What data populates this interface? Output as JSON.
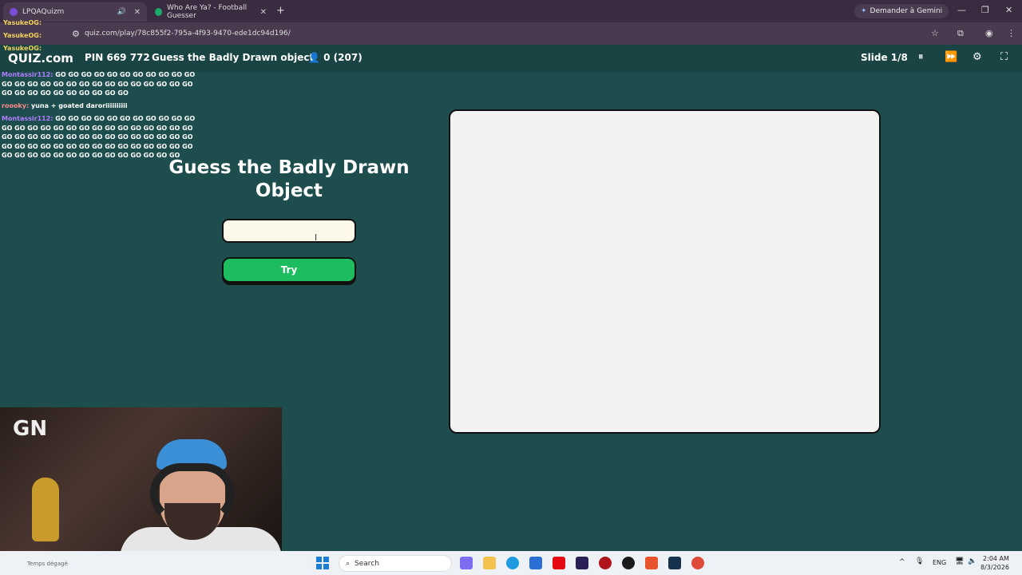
{
  "browser": {
    "tabs": [
      {
        "label": "LPQAQuizm"
      },
      {
        "label": "Who Are Ya? - Football Guesser"
      }
    ],
    "gemini_label": "Demander à Gemini",
    "url": "quiz.com/play/78c855f2-795a-4f93-9470-ede1dc94d196/"
  },
  "quiz_header": {
    "logo": "QUIZ.com",
    "pin": "PIN 669 772",
    "title": "Guess the Badly Drawn object",
    "players": "0 (207)",
    "slide": "Slide 1/8"
  },
  "chat": {
    "top_users": [
      "YasukeOG:",
      "YasukeOG:",
      "YasukeOG:"
    ],
    "messages": [
      {
        "user": "Montassir112:",
        "text": "GO GO GO GO GO GO GO GO GO GO GO GO GO GO GO GO GO GO GO GO GO GO GO GO GO GO GO GO GO GO GO GO GO GO GO GO"
      },
      {
        "user": "roooky:",
        "text": "yuna + goated daroriiiiiiiiii"
      },
      {
        "user": "Montassir112:",
        "text": "GO GO GO GO GO GO GO GO GO GO GO GO GO GO GO GO GO GO GO GO GO GO GO GO GO GO GO GO GO GO GO GO GO GO GO GO GO GO GO GO GO GO GO GO GO GO GO GO GO GO GO GO GO GO GO GO GO GO GO GO GO GO GO GO GO GO GO GO GO GO"
      }
    ]
  },
  "main": {
    "heading": "Guess the Badly Drawn Object",
    "answer_value": "",
    "try_label": "Try"
  },
  "webcam": {
    "logo": "GN",
    "caption": "Temps dégagé"
  },
  "taskbar": {
    "search_label": "Search",
    "language": "ENG",
    "time": "2:04 AM",
    "date": "8/3/2026"
  },
  "colors": {
    "page_bg": "#1e4d4d",
    "try_button": "#1dbd5f",
    "canvas_bg": "#f2f2f2",
    "answer_bg": "#fdf9ea"
  }
}
